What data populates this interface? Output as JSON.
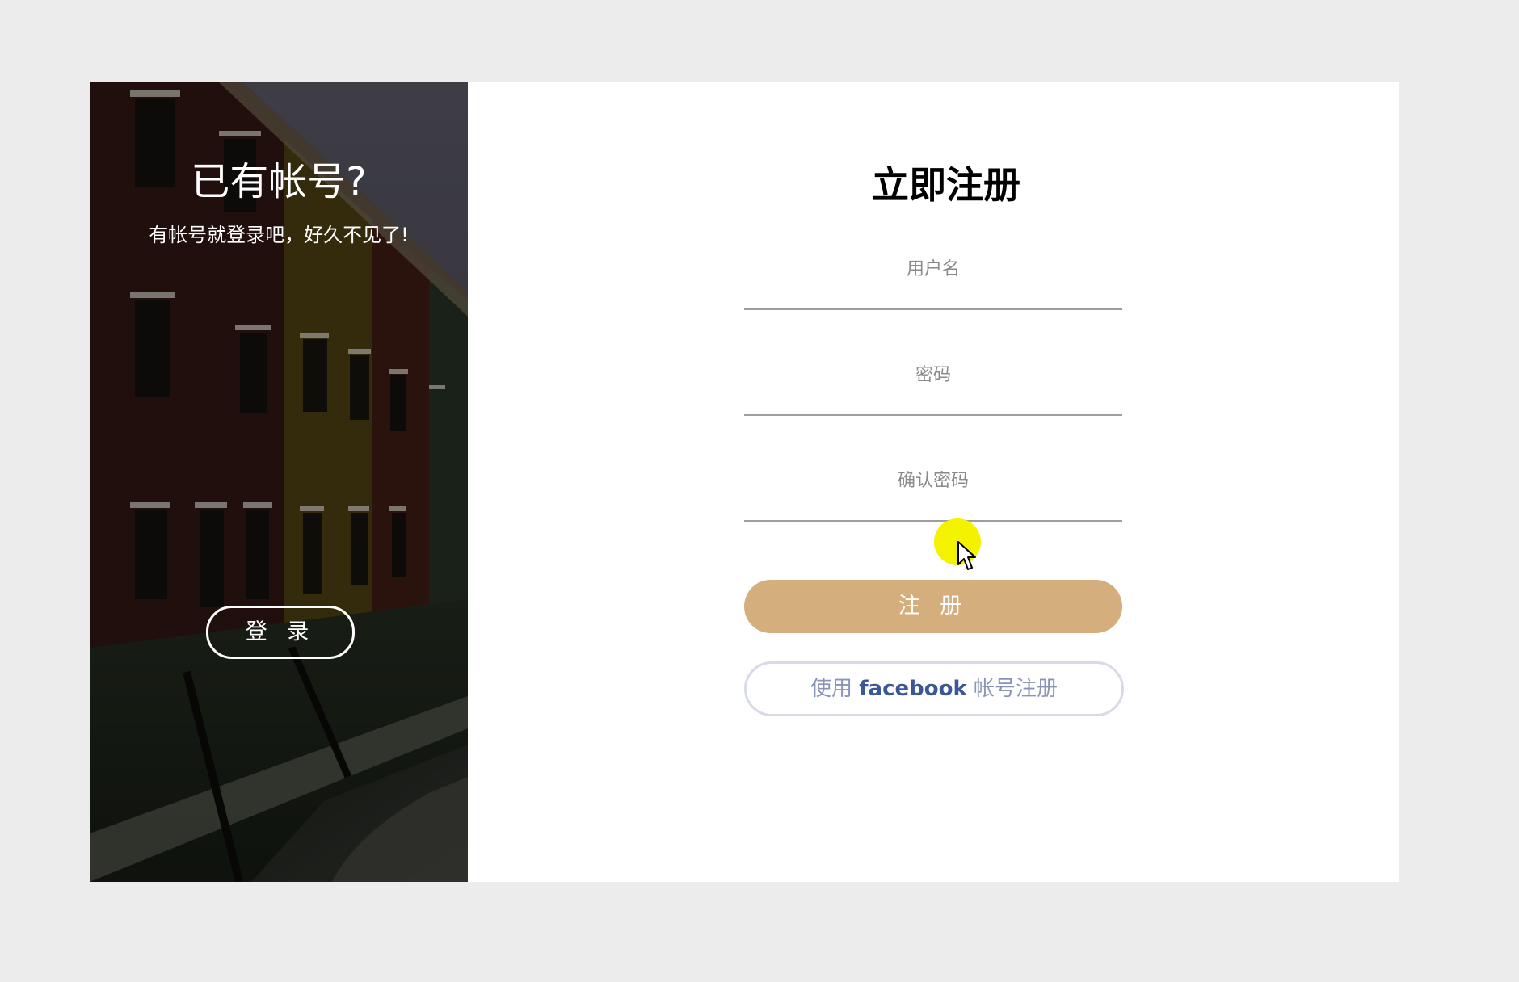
{
  "left_panel": {
    "title": "已有帐号?",
    "subtitle": "有帐号就登录吧，好久不见了!",
    "login_button_label": "登 录"
  },
  "form": {
    "title": "立即注册",
    "username_placeholder": "用户名",
    "password_placeholder": "密码",
    "confirm_password_placeholder": "确认密码",
    "submit_label": "注 册",
    "facebook_prefix": "使用 ",
    "facebook_brand": "facebook",
    "facebook_suffix": " 帐号注册"
  },
  "colors": {
    "page_background": "#ececec",
    "submit_button": "#d4ae7c",
    "facebook_brand": "#3b5795",
    "cursor_highlight": "#f5f200"
  }
}
